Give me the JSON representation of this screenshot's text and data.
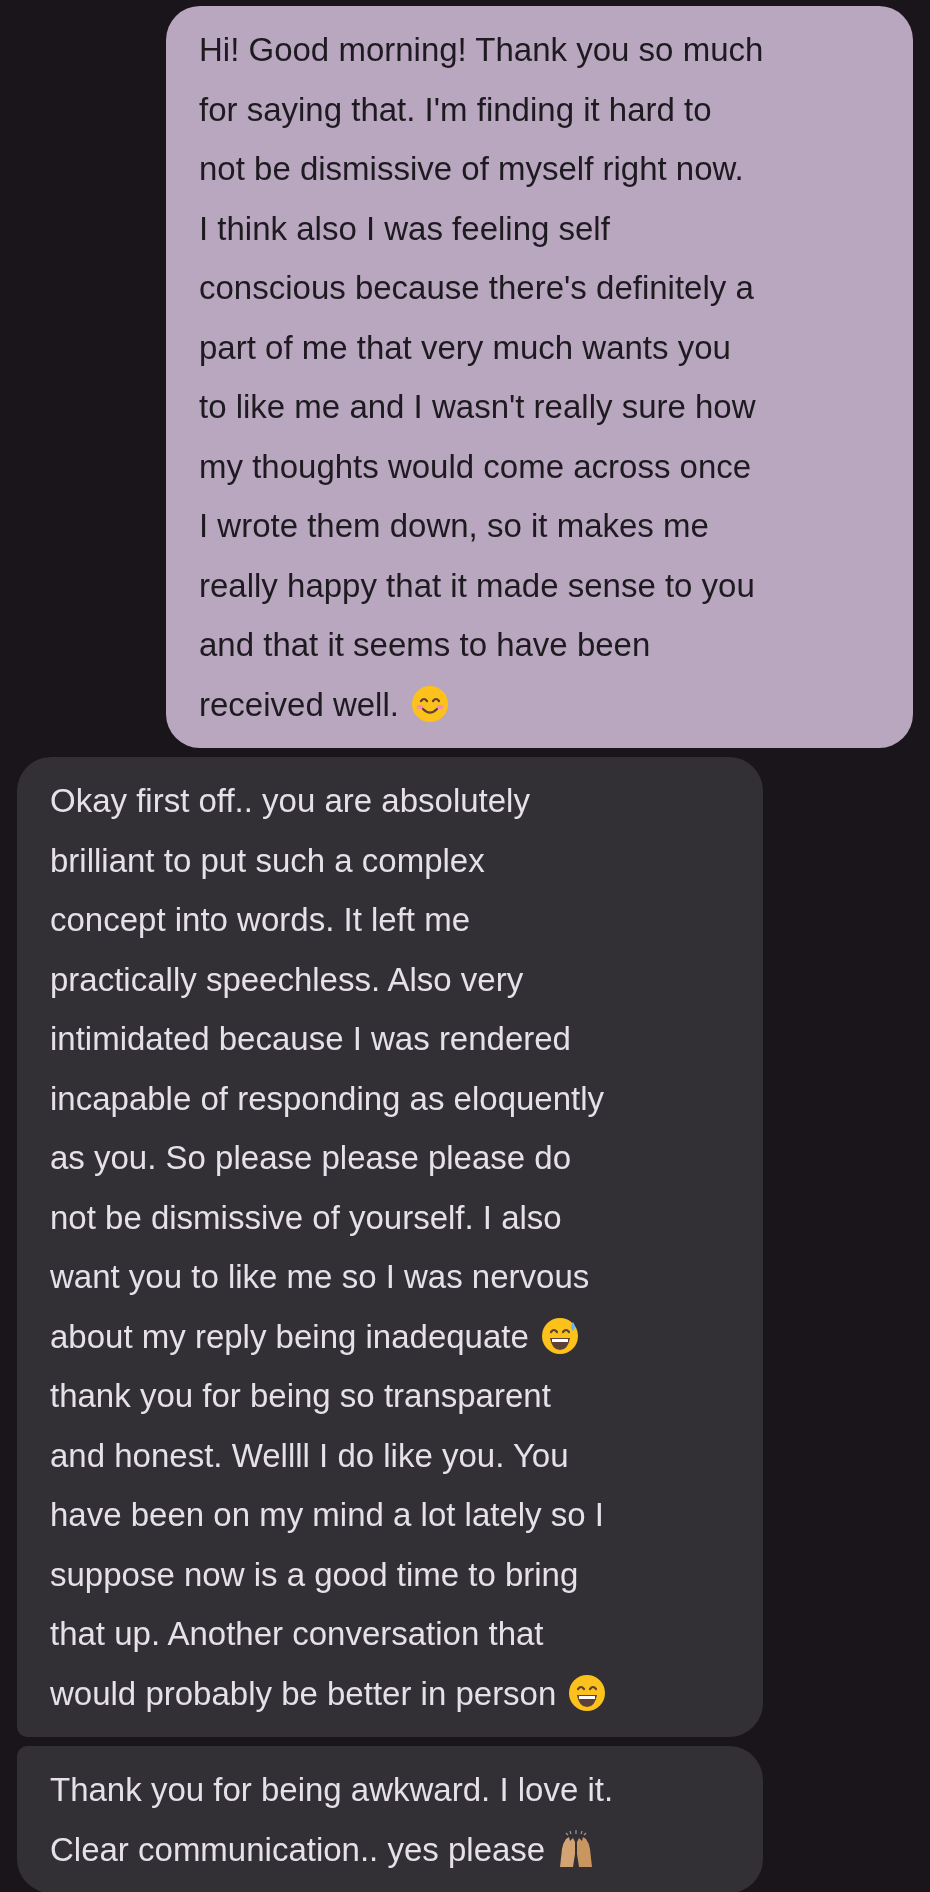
{
  "messages": [
    {
      "kind": "sent",
      "lines": [
        [
          {
            "kind": "text",
            "text": "Hi! Good morning! Thank you so much"
          }
        ],
        [
          {
            "kind": "text",
            "text": "for saying that. I'm finding it hard to"
          }
        ],
        [
          {
            "kind": "text",
            "text": "not be dismissive of myself right now."
          }
        ],
        [
          {
            "kind": "text",
            "text": "I think also I was feeling self"
          }
        ],
        [
          {
            "kind": "text",
            "text": "conscious because there's definitely a"
          }
        ],
        [
          {
            "kind": "text",
            "text": "part of me that very much wants you"
          }
        ],
        [
          {
            "kind": "text",
            "text": "to like me and I wasn't really sure how"
          }
        ],
        [
          {
            "kind": "text",
            "text": "my thoughts would come across once"
          }
        ],
        [
          {
            "kind": "text",
            "text": "I wrote them down, so it makes me"
          }
        ],
        [
          {
            "kind": "text",
            "text": "really happy that it made sense to you"
          }
        ],
        [
          {
            "kind": "text",
            "text": "and that it seems to have been"
          }
        ],
        [
          {
            "kind": "text",
            "text": "received well."
          },
          {
            "kind": "smile"
          }
        ]
      ]
    },
    {
      "kind": "received",
      "lines": [
        [
          {
            "kind": "text",
            "text": "Okay first off.. you are absolutely"
          }
        ],
        [
          {
            "kind": "text",
            "text": "brilliant to put such a complex"
          }
        ],
        [
          {
            "kind": "text",
            "text": "concept into words. It left me"
          }
        ],
        [
          {
            "kind": "text",
            "text": "practically speechless. Also very"
          }
        ],
        [
          {
            "kind": "text",
            "text": "intimidated because I was rendered"
          }
        ],
        [
          {
            "kind": "text",
            "text": "incapable of responding as eloquently"
          }
        ],
        [
          {
            "kind": "text",
            "text": "as you. So please please please do"
          }
        ],
        [
          {
            "kind": "text",
            "text": "not be dismissive of yourself. I also"
          }
        ],
        [
          {
            "kind": "text",
            "text": "want you to like me so I was nervous"
          }
        ],
        [
          {
            "kind": "text",
            "text": "about my reply being inadequate"
          },
          {
            "kind": "sweat-smile"
          }
        ],
        [
          {
            "kind": "text",
            "text": "thank you for being so transparent"
          }
        ],
        [
          {
            "kind": "text",
            "text": "and honest. Wellll I do like you. You"
          }
        ],
        [
          {
            "kind": "text",
            "text": "have been on my mind a lot lately so I"
          }
        ],
        [
          {
            "kind": "text",
            "text": "suppose now is a good time to bring"
          }
        ],
        [
          {
            "kind": "text",
            "text": "that up. Another conversation that"
          }
        ],
        [
          {
            "kind": "text",
            "text": "would probably be better in person"
          },
          {
            "kind": "grin"
          }
        ]
      ]
    },
    {
      "kind": "received",
      "lines": [
        [
          {
            "kind": "text",
            "text": "Thank you for being awkward. I love it."
          }
        ],
        [
          {
            "kind": "text",
            "text": "Clear communication.. yes please"
          },
          {
            "kind": "raised-hands"
          }
        ]
      ]
    }
  ]
}
